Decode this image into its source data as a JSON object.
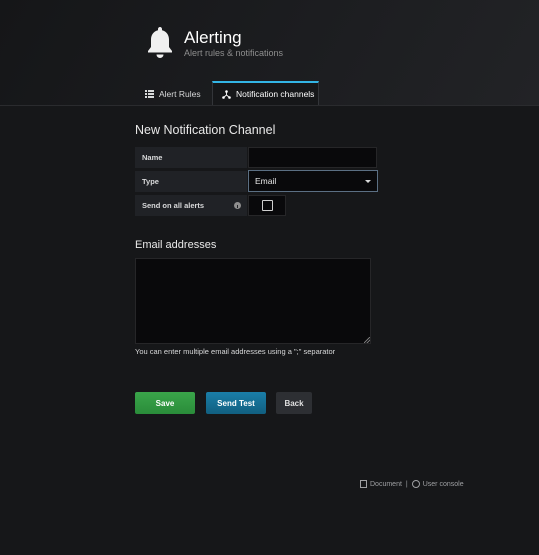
{
  "header": {
    "title": "Alerting",
    "subtitle": "Alert rules & notifications",
    "icon": "bell-icon"
  },
  "tabs": [
    {
      "label": "Alert Rules",
      "icon": "list-icon",
      "active": false
    },
    {
      "label": "Notification channels",
      "icon": "share-icon",
      "active": true
    }
  ],
  "form": {
    "title": "New Notification Channel",
    "name_label": "Name",
    "name_value": "",
    "type_label": "Type",
    "type_value": "Email",
    "send_all_label": "Send on all alerts",
    "send_all_checked": false,
    "email_title": "Email addresses",
    "email_value": "",
    "help": "You can enter multiple email addresses using a \";\" separator"
  },
  "buttons": {
    "save": "Save",
    "test": "Send Test",
    "back": "Back"
  },
  "footer": {
    "doc": "Document",
    "separator": "|",
    "console": "User console"
  },
  "colors": {
    "accent_tab": "#33b5e5",
    "save": "#2f9b41",
    "test": "#14709a"
  }
}
